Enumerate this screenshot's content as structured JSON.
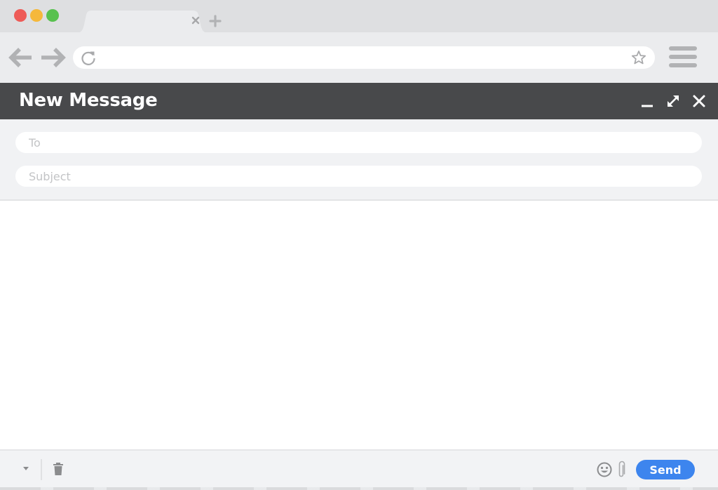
{
  "browser": {
    "window_controls": [
      {
        "name": "close",
        "color": "#ee5b57"
      },
      {
        "name": "minimize",
        "color": "#f5b83b"
      },
      {
        "name": "zoom",
        "color": "#58c14f"
      }
    ],
    "tabs": [
      {
        "title": "",
        "close_icon": "close-icon"
      }
    ],
    "new_tab_icon": "plus-icon",
    "nav": {
      "back_icon": "arrow-left-icon",
      "forward_icon": "arrow-right-icon",
      "reload_icon": "reload-icon"
    },
    "address_bar": {
      "value": "",
      "placeholder": ""
    },
    "bookmark_icon": "star-icon",
    "menu_icon": "hamburger-menu-icon"
  },
  "compose": {
    "title": "New Message",
    "header_controls": [
      "minimize-icon",
      "expand-icon",
      "close-icon"
    ],
    "fields": {
      "to": {
        "value": "",
        "placeholder": "To"
      },
      "subject": {
        "value": "",
        "placeholder": "Subject"
      }
    },
    "body": {
      "value": ""
    },
    "footer": {
      "more_options_icon": "caret-down-icon",
      "discard_icon": "trash-icon",
      "emoji_icon": "smiley-icon",
      "attach_icon": "paperclip-icon",
      "send_label": "Send"
    }
  },
  "colors": {
    "header_bg": "#48494b",
    "send_button": "#3d85ee",
    "icon_gray": "#b1b2b4"
  }
}
